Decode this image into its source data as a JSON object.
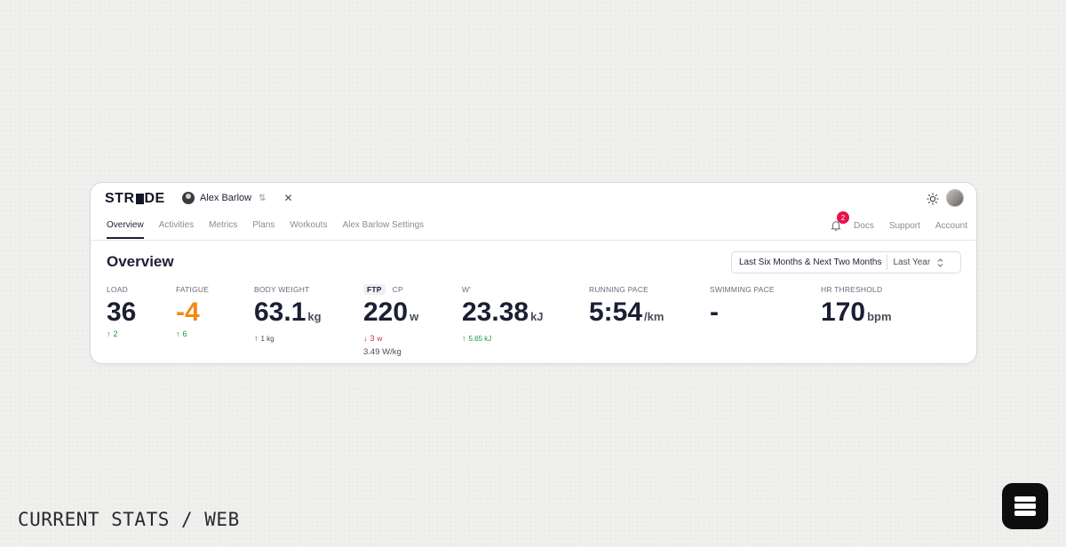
{
  "app": {
    "logo_text_left": "STR",
    "logo_text_right": "DE",
    "context_user": "Alex Barlow",
    "switch_glyph": "⇅",
    "close_glyph": "✕"
  },
  "nav": {
    "tabs": [
      {
        "label": "Overview",
        "active": true
      },
      {
        "label": "Activities",
        "active": false
      },
      {
        "label": "Metrics",
        "active": false
      },
      {
        "label": "Plans",
        "active": false
      },
      {
        "label": "Workouts",
        "active": false
      },
      {
        "label": "Alex Barlow Settings",
        "active": false
      }
    ],
    "notifications_count": "2",
    "links": [
      "Docs",
      "Support",
      "Account"
    ]
  },
  "overview": {
    "title": "Overview",
    "range_label": "Last Six Months & Next Two Months",
    "compare_label": "Last Year"
  },
  "metrics": {
    "load": {
      "label": "LOAD",
      "value": "36",
      "delta_arrow": "↑",
      "delta": "2"
    },
    "fatigue": {
      "label": "FATIGUE",
      "value": "-4",
      "delta_arrow": "↑",
      "delta": "6"
    },
    "body_weight": {
      "label": "BODY WEIGHT",
      "value": "63.1",
      "unit": "kg",
      "delta_arrow": "↑",
      "delta": "1 kg"
    },
    "power": {
      "tab_ftp": "FTP",
      "tab_cp": "CP",
      "value": "220",
      "unit": "w",
      "delta_arrow": "↓",
      "delta": "3",
      "delta_unit": "w",
      "sub": "3.49 W/kg"
    },
    "w_prime": {
      "label": "W'",
      "value": "23.38",
      "unit": "kJ",
      "delta_arrow": "↑",
      "delta": "5.65 kJ"
    },
    "running_pace": {
      "label": "RUNNING PACE",
      "value": "5:54",
      "unit": "/km"
    },
    "swimming_pace": {
      "label": "SWIMMING PACE",
      "value": "-"
    },
    "hr_threshold": {
      "label": "HR THRESHOLD",
      "value": "170",
      "unit": "bpm"
    }
  },
  "footer": {
    "label": "CURRENT STATS / WEB"
  },
  "colors": {
    "accent_orange": "#f08a14",
    "up_green": "#1a9a3a",
    "down_red": "#d61f4b",
    "badge": "#e5124a"
  }
}
